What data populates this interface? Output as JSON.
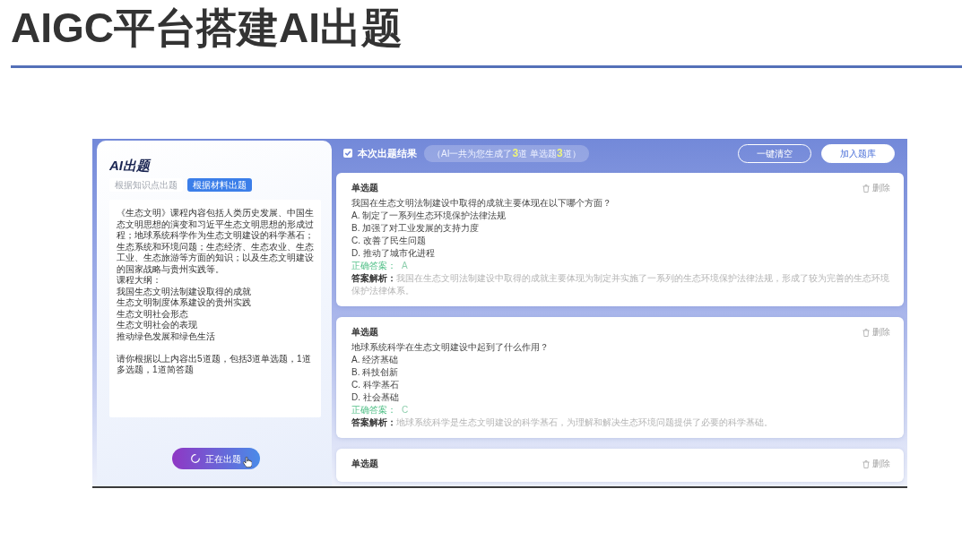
{
  "slide": {
    "title": "AIGC平台搭建AI出题"
  },
  "left_panel": {
    "logo": "AI出题",
    "tabs": [
      {
        "label": "根据知识点出题",
        "selected": false
      },
      {
        "label": "根据材料出题",
        "selected": true
      }
    ],
    "material": {
      "blocks": [
        {
          "lines": [
            "《生态文明》课程内容包括人类历史发展、中国生态文明思想的演变和习近平生态文明思想的形成过程；地球系统科学作为生态文明建设的科学基石；生态系统和环境问题；生态经济、生态农业、生态工业、生态旅游等方面的知识；以及生态文明建设的国家战略与贵州实践等。",
            "课程大纲：",
            "我国生态文明法制建设取得的成就",
            "生态文明制度体系建设的贵州实践",
            "生态文明社会形态",
            "生态文明社会的表现",
            "推动绿色发展和绿色生活"
          ]
        },
        {
          "lines": [
            "请你根据以上内容出5道题，包括3道单选题，1道多选题，1道简答题"
          ]
        }
      ]
    },
    "generate_button": {
      "label": "正在出题",
      "loading": true
    }
  },
  "results": {
    "checked": true,
    "title": "本次出题结果",
    "summary": "（AI一共为您生成了**3**道 单选题**3**道）",
    "buttons": [
      {
        "label": "一键清空",
        "kind": "outline"
      },
      {
        "label": "加入题库",
        "kind": "filled"
      }
    ],
    "questions": [
      {
        "type": "单选题",
        "delete": "删除",
        "question": "我国在生态文明法制建设中取得的成就主要体现在以下哪个方面？",
        "options": [
          "A. 制定了一系列生态环境保护法律法规",
          "B. 加强了对工业发展的支持力度",
          "C. 改善了民生问题",
          "D. 推动了城市化进程"
        ],
        "answer_label": "正确答案：",
        "answer": "A",
        "analysis": "**答案解析：**我国在生态文明法制建设中取得的成就主要体现为制定并实施了一系列的生态环境保护法律法规，形成了较为完善的生态环境保护法律体系。"
      },
      {
        "type": "单选题",
        "delete": "删除",
        "question": "地球系统科学在生态文明建设中起到了什么作用？",
        "options": [
          "A. 经济基础",
          "B. 科技创新",
          "C. 科学基石",
          "D. 社会基础"
        ],
        "answer_label": "正确答案：",
        "answer": "C",
        "analysis": "**答案解析：**地球系统科学是生态文明建设的科学基石，为理解和解决生态环境问题提供了必要的科学基础。"
      },
      {
        "type": "单选题",
        "delete": "删除"
      }
    ]
  }
}
